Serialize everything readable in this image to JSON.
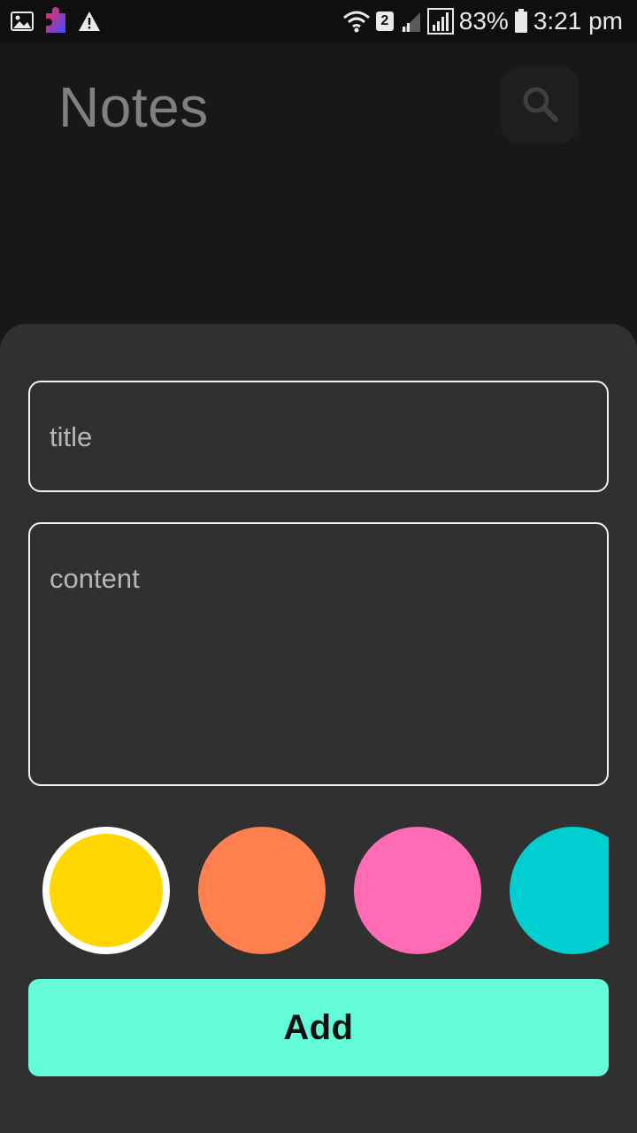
{
  "status_bar": {
    "battery": "83%",
    "time": "3:21 pm",
    "sim_slot": "2",
    "left_icons": [
      "image-icon",
      "puzzle-icon",
      "warning-icon"
    ],
    "right_icons": [
      "wifi-icon",
      "sim-badge-icon",
      "signal-weak-icon",
      "signal-full-icon",
      "battery-icon"
    ]
  },
  "app": {
    "title": "Notes",
    "search_icon": "search-icon"
  },
  "sheet": {
    "title_placeholder": "title",
    "content_placeholder": "content",
    "add_label": "Add",
    "colors": [
      {
        "hex": "#FFD600",
        "selected": true
      },
      {
        "hex": "#FF7F4F",
        "selected": false
      },
      {
        "hex": "#FF6BB5",
        "selected": false
      },
      {
        "hex": "#00CED1",
        "selected": false
      }
    ]
  },
  "theme": {
    "background": "#181818",
    "sheet": "#303030",
    "accent": "#64FCD9",
    "border": "#F2F2F2",
    "placeholder": "#B6B6B6"
  }
}
